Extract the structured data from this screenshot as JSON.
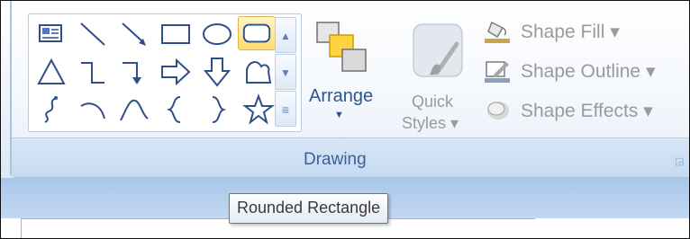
{
  "ribbon": {
    "group_label": "Drawing",
    "shapes_gallery": {
      "rows": [
        [
          "text-box",
          "line",
          "arrow",
          "rectangle",
          "oval",
          "rounded-rectangle"
        ],
        [
          "triangle",
          "elbow-connector",
          "elbow-arrow-connector",
          "right-arrow",
          "down-arrow",
          "freeform"
        ],
        [
          "curved-connector",
          "arc",
          "curve",
          "left-brace",
          "right-brace",
          "star"
        ]
      ],
      "selected": "rounded-rectangle"
    },
    "arrange": {
      "label": "Arrange"
    },
    "quick_styles": {
      "line1": "Quick",
      "line2": "Styles"
    },
    "commands": [
      {
        "label": "Shape Fill",
        "icon": "paint-bucket-icon"
      },
      {
        "label": "Shape Outline",
        "icon": "pen-outline-icon"
      },
      {
        "label": "Shape Effects",
        "icon": "shape-effects-icon"
      }
    ]
  },
  "tooltip": {
    "text": "Rounded Rectangle"
  },
  "colors": {
    "accent": "#3e5f96",
    "highlight": "#ffdc70",
    "band": "#b4cdee"
  }
}
